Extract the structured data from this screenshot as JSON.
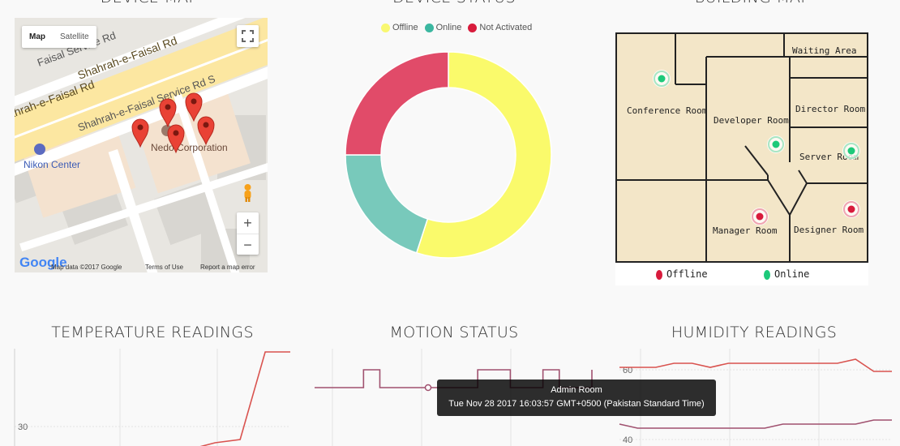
{
  "titles": {
    "device_map": "DEVICE MAP",
    "device_status": "DEVICE STATUS",
    "building_map": "BUILDING MAP",
    "temperature": "TEMPERATURE READINGS",
    "motion": "MOTION STATUS",
    "humidity": "HUMIDITY READINGS"
  },
  "map": {
    "type_map": "Map",
    "type_satellite": "Satellite",
    "streets": [
      "Shahrah-e-Faisal Rd",
      "Shahrah-e-Faisal Rd",
      "Shahrah-e-Faisal Service Rd S",
      "Faisal Service Rd"
    ],
    "places": [
      "Nedo Corporation",
      "Nikon Center"
    ],
    "brand": "Google",
    "footer": {
      "map_data": "Map data ©2017 Google",
      "terms": "Terms of Use",
      "report": "Report a map error"
    },
    "zoom_in": "+",
    "zoom_out": "−"
  },
  "status_legend": [
    {
      "label": "Offline",
      "color": "#f9f871"
    },
    {
      "label": "Online",
      "color": "#3bb7a0"
    },
    {
      "label": "Not Activated",
      "color": "#d81b3c"
    }
  ],
  "chart_data": [
    {
      "type": "pie",
      "categories": [
        "Offline",
        "Online",
        "Not Activated"
      ],
      "values": [
        55,
        20,
        25
      ],
      "colors": [
        "#fafa6b",
        "#78c9bb",
        "#e14b69"
      ],
      "title": "DEVICE STATUS"
    },
    {
      "type": "line",
      "title": "TEMPERATURE READINGS",
      "yticks": [
        "30"
      ],
      "series": [
        {
          "values": [
            0,
            0,
            0,
            0,
            0,
            0,
            0,
            0,
            2,
            3,
            30,
            30
          ],
          "color": "#d9534f"
        }
      ]
    },
    {
      "type": "line",
      "title": "MOTION STATUS",
      "series": [
        {
          "values": [
            0,
            0,
            0,
            1,
            0,
            0,
            0,
            0,
            0,
            0,
            1,
            1,
            0,
            0,
            1,
            0,
            0,
            1
          ],
          "color": "#a0516f"
        }
      ]
    },
    {
      "type": "line",
      "title": "HUMIDITY READINGS",
      "yticks": [
        "60",
        "40"
      ],
      "series": [
        {
          "values": [
            61,
            61,
            61,
            62,
            62,
            61,
            62,
            62,
            62,
            62,
            62,
            62,
            62,
            63,
            60,
            60
          ],
          "color": "#d9534f"
        },
        {
          "values": [
            47,
            46,
            46,
            46,
            46,
            46,
            46,
            46,
            46,
            47,
            47,
            47,
            47,
            47,
            48,
            48
          ],
          "color": "#a0516f"
        }
      ]
    }
  ],
  "building": {
    "rooms": [
      "Waiting Area",
      "Conference Room",
      "Developer Room",
      "Director Room",
      "Server Room",
      "Manager Room",
      "Designer Room"
    ],
    "legend_offline": "Offline",
    "legend_online": "Online",
    "offline_color": "#d81b3c",
    "online_color": "#1dc97a"
  },
  "tooltip": {
    "title": "Admin Room",
    "time": "Tue Nov 28 2017 16:03:57 GMT+0500 (Pakistan Standard Time)"
  }
}
